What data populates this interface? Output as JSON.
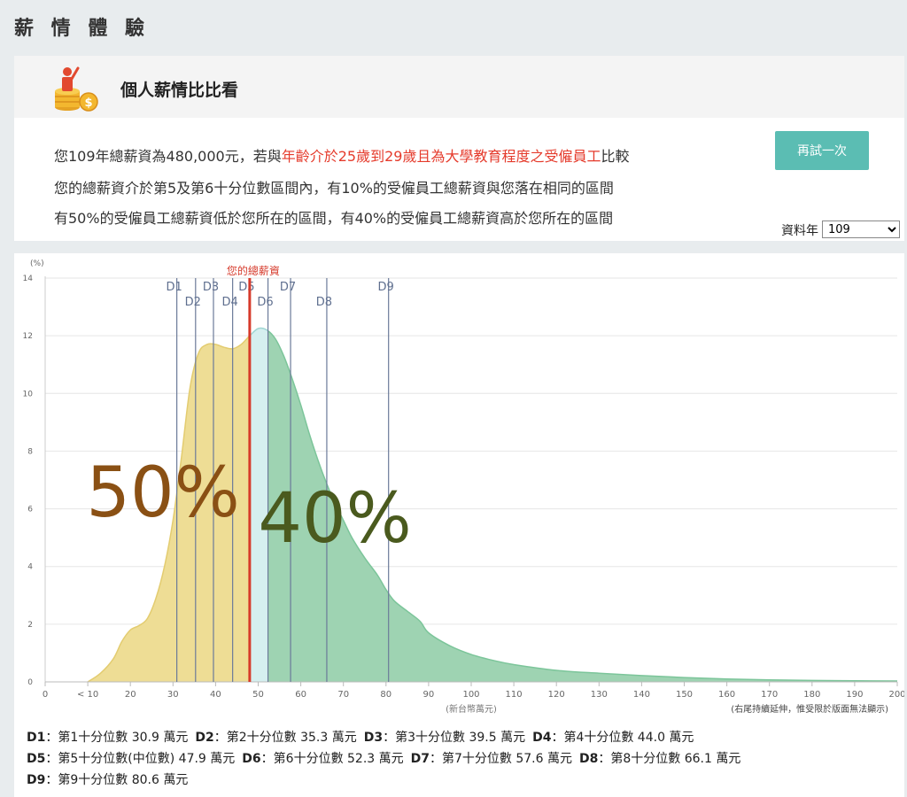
{
  "page": {
    "title": "薪 情 體 驗"
  },
  "panel": {
    "title": "個人薪情比比看",
    "line1_pre": "您109年總薪資為480,000元，若與",
    "line1_hl": "年齡介於25歲到29歲且為大學教育程度之受僱員工",
    "line1_post": "比較",
    "line2": "您的總薪資介於第5及第6十分位數區間內，有10%的受僱員工總薪資與您落在相同的區間",
    "line3": "有50%的受僱員工總薪資低於您所在的區間，有40%的受僱員工總薪資高於您所在的區間",
    "retry_label": "再試一次",
    "year_label": "資料年",
    "year_value": "109"
  },
  "colors": {
    "below": "#eedd95",
    "above": "#9ed3b2",
    "between": "#d5efef",
    "my_line": "#d63a2b",
    "decile_line": "#6b7a99",
    "pct_low_text": "#8a5014",
    "pct_high_text": "#4a5a1e"
  },
  "chart_data": {
    "type": "area",
    "ylabel": "(%)",
    "xlabel": "(新台幣萬元)",
    "note": "(右尾持續延伸，惟受限於版面無法顯示)",
    "xlim": [
      0,
      200
    ],
    "ylim": [
      0,
      14
    ],
    "x_ticks": [
      0,
      10,
      20,
      30,
      40,
      50,
      60,
      70,
      80,
      90,
      100,
      110,
      120,
      130,
      140,
      150,
      160,
      170,
      180,
      190,
      200
    ],
    "x_tick_labels": [
      "0",
      "< 10",
      "20",
      "30",
      "40",
      "50",
      "60",
      "70",
      "80",
      "90",
      "100",
      "110",
      "120",
      "130",
      "140",
      "150",
      "160",
      "170",
      "180",
      "190",
      "200"
    ],
    "y_ticks": [
      0,
      2,
      4,
      6,
      8,
      10,
      12,
      14
    ],
    "y_tick_labels": [
      "0",
      "2",
      "4",
      "6",
      "8",
      "10",
      "12",
      "14"
    ],
    "x": [
      10,
      13,
      16,
      18,
      20,
      22,
      24,
      26,
      28,
      30,
      32,
      34,
      36,
      38,
      40,
      42,
      44,
      46,
      48,
      50,
      52,
      54,
      56,
      58,
      60,
      62,
      64,
      66,
      68,
      70,
      72,
      75,
      78,
      80,
      82,
      85,
      88,
      90,
      95,
      100,
      105,
      110,
      120,
      130,
      140,
      150,
      160,
      170,
      180,
      190,
      200
    ],
    "y": [
      0,
      0.3,
      0.8,
      1.4,
      1.8,
      1.95,
      2.2,
      2.9,
      4.0,
      5.6,
      7.8,
      10.2,
      11.4,
      11.7,
      11.7,
      11.6,
      11.55,
      11.7,
      12.0,
      12.25,
      12.2,
      11.9,
      11.3,
      10.5,
      9.6,
      8.6,
      7.7,
      6.9,
      6.2,
      5.6,
      5.0,
      4.3,
      3.7,
      3.2,
      2.8,
      2.45,
      2.1,
      1.7,
      1.25,
      0.95,
      0.75,
      0.6,
      0.4,
      0.3,
      0.22,
      0.15,
      0.1,
      0.07,
      0.05,
      0.04,
      0.03
    ],
    "deciles": [
      {
        "name": "D1",
        "value": 30.9,
        "desc": "：第1十分位數 30.9 萬元"
      },
      {
        "name": "D2",
        "value": 35.3,
        "desc": "：第2十分位數 35.3 萬元"
      },
      {
        "name": "D3",
        "value": 39.5,
        "desc": "：第3十分位數 39.5 萬元"
      },
      {
        "name": "D4",
        "value": 44.0,
        "desc": "：第4十分位數 44.0 萬元"
      },
      {
        "name": "D5",
        "value": 47.9,
        "desc": "：第5十分位數(中位數) 47.9 萬元"
      },
      {
        "name": "D6",
        "value": 52.3,
        "desc": "：第6十分位數 52.3 萬元"
      },
      {
        "name": "D7",
        "value": 57.6,
        "desc": "：第7十分位數 57.6 萬元"
      },
      {
        "name": "D8",
        "value": 66.1,
        "desc": "：第8十分位數 66.1 萬元"
      },
      {
        "name": "D9",
        "value": 80.6,
        "desc": "：第9十分位數 80.6 萬元"
      }
    ],
    "my_salary": {
      "value": 48,
      "label": "您的總薪資"
    },
    "pct_below": {
      "label": "50%",
      "x": 31,
      "y": 6.3
    },
    "pct_above": {
      "label": "40%",
      "x": 68,
      "y": 5.4
    }
  }
}
